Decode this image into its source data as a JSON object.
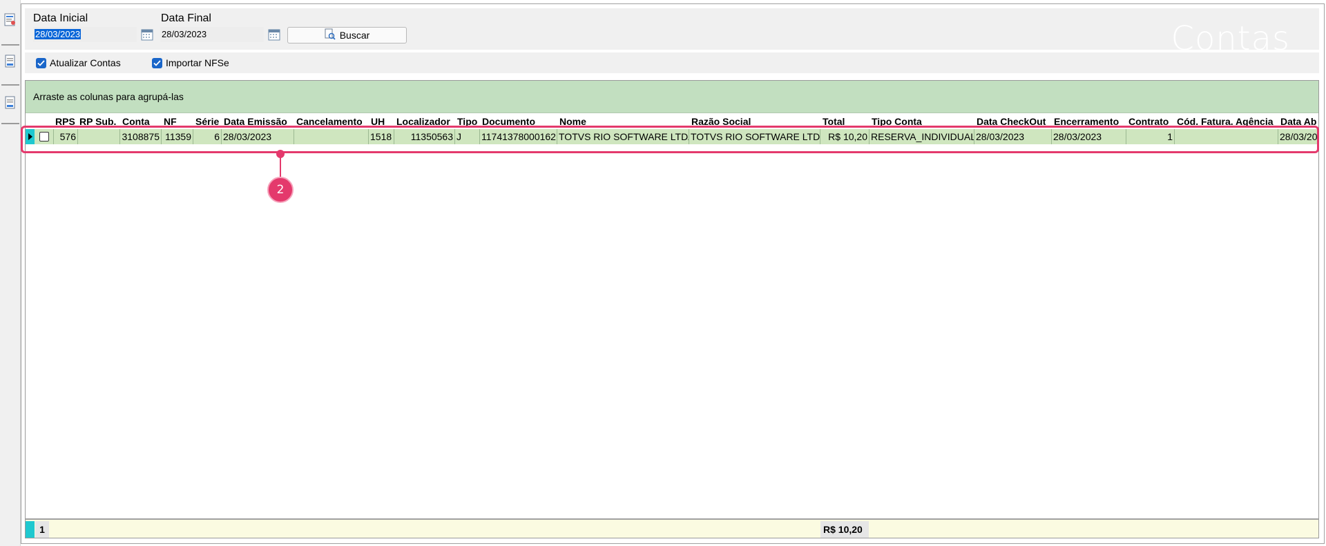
{
  "filters": {
    "data_inicial_label": "Data Inicial",
    "data_inicial_value": "28/03/2023",
    "data_final_label": "Data Final",
    "data_final_value": "28/03/2023",
    "buscar_label": "Buscar",
    "screen_title": "Contas"
  },
  "options": {
    "atualizar_contas": "Atualizar Contas",
    "importar_nfse": "Importar NFSe"
  },
  "grid": {
    "group_hint": "Arraste as colunas para agrupá-las",
    "columns": [
      "RPS",
      "RP Sub.",
      "Conta",
      "NF",
      "Série",
      "Data Emissão",
      "Cancelamento",
      "UH",
      "Localizador",
      "Tipo",
      "Documento",
      "Nome",
      "Razão Social",
      "Total",
      "Tipo Conta",
      "Data CheckOut",
      "Encerramento",
      "Contrato",
      "Cód. Fatura. Agência",
      "Data Ab"
    ],
    "rows": [
      {
        "rps": "576",
        "rp_sub": "",
        "conta": "3108875",
        "nf": "11359",
        "serie": "6",
        "data_emissao": "28/03/2023",
        "cancelamento": "",
        "uh": "1518",
        "localizador": "11350563",
        "tipo": "J",
        "documento": "11741378000162",
        "nome": "TOTVS RIO SOFTWARE LTDA",
        "razao_social": "TOTVS RIO SOFTWARE LTDA",
        "total": "R$ 10,20",
        "tipo_conta": "RESERVA_INDIVIDUAL",
        "data_checkout": "28/03/2023",
        "encerramento": "28/03/2023",
        "contrato": "1",
        "cod_fatura_agencia": "",
        "data_ab": "28/03/20"
      }
    ],
    "footer_count": "1",
    "footer_total": "R$ 10,20"
  },
  "annotation": {
    "step_number": "2",
    "color": "#e4396c"
  }
}
